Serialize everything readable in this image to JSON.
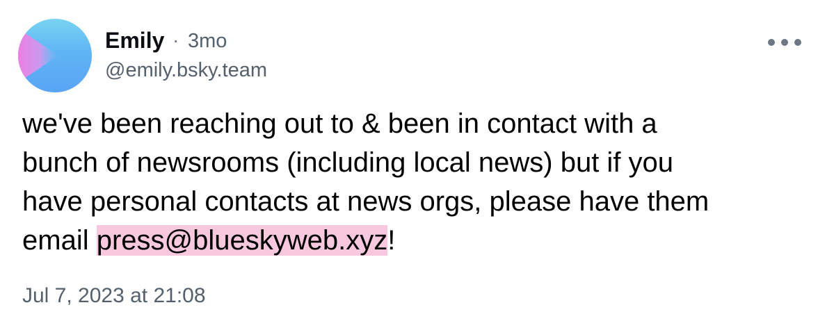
{
  "post": {
    "author_name": "Emily",
    "separator": "·",
    "relative_time": "3mo",
    "handle": "@emily.bsky.team",
    "text_line_1": "we've been reaching out to & been in contact with a",
    "text_line_2": "bunch of newsrooms (including local news) but if you",
    "text_line_3": "have personal contacts at news orgs, please have them",
    "text_line_4_prefix": "email ",
    "email": "press@blueskyweb.xyz",
    "text_line_4_suffix": "!",
    "date": "Jul 7, 2023 at 21:08",
    "more_icon": "more-horizontal-icon"
  },
  "colors": {
    "avatar_gradient": [
      "#79d3f2",
      "#5aa4f6",
      "#ee7fe0"
    ],
    "email_highlight": "#f8c8df",
    "secondary_text": "#55606d"
  }
}
